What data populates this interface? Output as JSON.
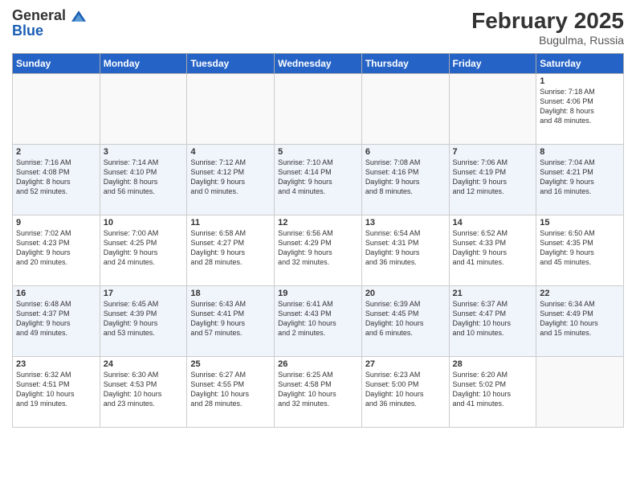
{
  "header": {
    "logo_line1": "General",
    "logo_line2": "Blue",
    "month_title": "February 2025",
    "location": "Bugulma, Russia"
  },
  "days_of_week": [
    "Sunday",
    "Monday",
    "Tuesday",
    "Wednesday",
    "Thursday",
    "Friday",
    "Saturday"
  ],
  "weeks": [
    [
      {
        "day": "",
        "info": ""
      },
      {
        "day": "",
        "info": ""
      },
      {
        "day": "",
        "info": ""
      },
      {
        "day": "",
        "info": ""
      },
      {
        "day": "",
        "info": ""
      },
      {
        "day": "",
        "info": ""
      },
      {
        "day": "1",
        "info": "Sunrise: 7:18 AM\nSunset: 4:06 PM\nDaylight: 8 hours\nand 48 minutes."
      }
    ],
    [
      {
        "day": "2",
        "info": "Sunrise: 7:16 AM\nSunset: 4:08 PM\nDaylight: 8 hours\nand 52 minutes."
      },
      {
        "day": "3",
        "info": "Sunrise: 7:14 AM\nSunset: 4:10 PM\nDaylight: 8 hours\nand 56 minutes."
      },
      {
        "day": "4",
        "info": "Sunrise: 7:12 AM\nSunset: 4:12 PM\nDaylight: 9 hours\nand 0 minutes."
      },
      {
        "day": "5",
        "info": "Sunrise: 7:10 AM\nSunset: 4:14 PM\nDaylight: 9 hours\nand 4 minutes."
      },
      {
        "day": "6",
        "info": "Sunrise: 7:08 AM\nSunset: 4:16 PM\nDaylight: 9 hours\nand 8 minutes."
      },
      {
        "day": "7",
        "info": "Sunrise: 7:06 AM\nSunset: 4:19 PM\nDaylight: 9 hours\nand 12 minutes."
      },
      {
        "day": "8",
        "info": "Sunrise: 7:04 AM\nSunset: 4:21 PM\nDaylight: 9 hours\nand 16 minutes."
      }
    ],
    [
      {
        "day": "9",
        "info": "Sunrise: 7:02 AM\nSunset: 4:23 PM\nDaylight: 9 hours\nand 20 minutes."
      },
      {
        "day": "10",
        "info": "Sunrise: 7:00 AM\nSunset: 4:25 PM\nDaylight: 9 hours\nand 24 minutes."
      },
      {
        "day": "11",
        "info": "Sunrise: 6:58 AM\nSunset: 4:27 PM\nDaylight: 9 hours\nand 28 minutes."
      },
      {
        "day": "12",
        "info": "Sunrise: 6:56 AM\nSunset: 4:29 PM\nDaylight: 9 hours\nand 32 minutes."
      },
      {
        "day": "13",
        "info": "Sunrise: 6:54 AM\nSunset: 4:31 PM\nDaylight: 9 hours\nand 36 minutes."
      },
      {
        "day": "14",
        "info": "Sunrise: 6:52 AM\nSunset: 4:33 PM\nDaylight: 9 hours\nand 41 minutes."
      },
      {
        "day": "15",
        "info": "Sunrise: 6:50 AM\nSunset: 4:35 PM\nDaylight: 9 hours\nand 45 minutes."
      }
    ],
    [
      {
        "day": "16",
        "info": "Sunrise: 6:48 AM\nSunset: 4:37 PM\nDaylight: 9 hours\nand 49 minutes."
      },
      {
        "day": "17",
        "info": "Sunrise: 6:45 AM\nSunset: 4:39 PM\nDaylight: 9 hours\nand 53 minutes."
      },
      {
        "day": "18",
        "info": "Sunrise: 6:43 AM\nSunset: 4:41 PM\nDaylight: 9 hours\nand 57 minutes."
      },
      {
        "day": "19",
        "info": "Sunrise: 6:41 AM\nSunset: 4:43 PM\nDaylight: 10 hours\nand 2 minutes."
      },
      {
        "day": "20",
        "info": "Sunrise: 6:39 AM\nSunset: 4:45 PM\nDaylight: 10 hours\nand 6 minutes."
      },
      {
        "day": "21",
        "info": "Sunrise: 6:37 AM\nSunset: 4:47 PM\nDaylight: 10 hours\nand 10 minutes."
      },
      {
        "day": "22",
        "info": "Sunrise: 6:34 AM\nSunset: 4:49 PM\nDaylight: 10 hours\nand 15 minutes."
      }
    ],
    [
      {
        "day": "23",
        "info": "Sunrise: 6:32 AM\nSunset: 4:51 PM\nDaylight: 10 hours\nand 19 minutes."
      },
      {
        "day": "24",
        "info": "Sunrise: 6:30 AM\nSunset: 4:53 PM\nDaylight: 10 hours\nand 23 minutes."
      },
      {
        "day": "25",
        "info": "Sunrise: 6:27 AM\nSunset: 4:55 PM\nDaylight: 10 hours\nand 28 minutes."
      },
      {
        "day": "26",
        "info": "Sunrise: 6:25 AM\nSunset: 4:58 PM\nDaylight: 10 hours\nand 32 minutes."
      },
      {
        "day": "27",
        "info": "Sunrise: 6:23 AM\nSunset: 5:00 PM\nDaylight: 10 hours\nand 36 minutes."
      },
      {
        "day": "28",
        "info": "Sunrise: 6:20 AM\nSunset: 5:02 PM\nDaylight: 10 hours\nand 41 minutes."
      },
      {
        "day": "",
        "info": ""
      }
    ]
  ]
}
